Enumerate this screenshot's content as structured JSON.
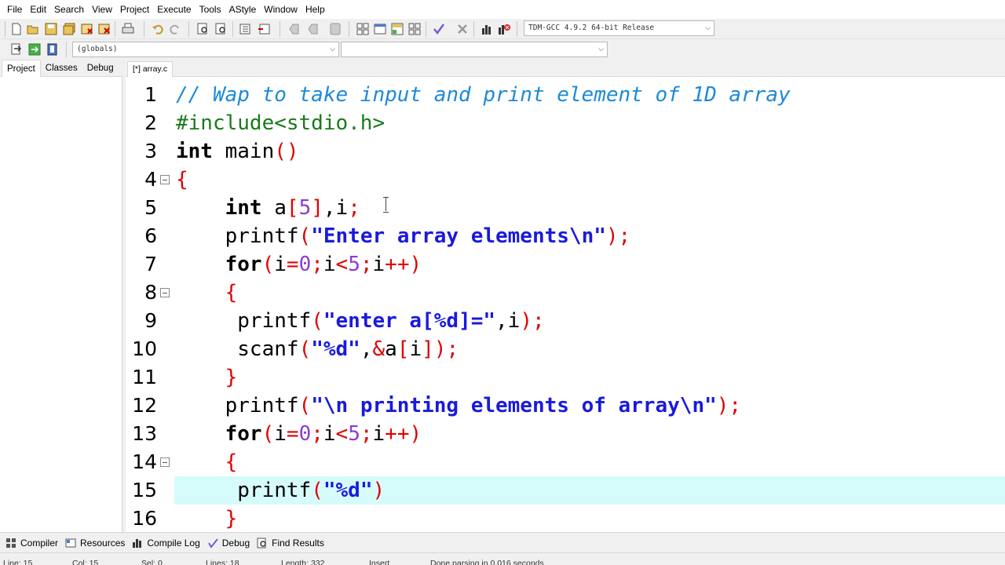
{
  "menu": [
    "File",
    "Edit",
    "Search",
    "View",
    "Project",
    "Execute",
    "Tools",
    "AStyle",
    "Window",
    "Help"
  ],
  "toolbar": {
    "compiler_select": "TDM-GCC 4.9.2 64-bit Release",
    "scope_select": "(globals)",
    "symbol_select": ""
  },
  "left_panel": {
    "tabs": [
      "Project",
      "Classes",
      "Debug"
    ],
    "active_tab": "Project"
  },
  "editor": {
    "tab_label": "[*] array.c",
    "current_line": 15,
    "lines": [
      {
        "n": "1",
        "fold": false
      },
      {
        "n": "2",
        "fold": false
      },
      {
        "n": "3",
        "fold": false
      },
      {
        "n": "4",
        "fold": true
      },
      {
        "n": "5",
        "fold": false
      },
      {
        "n": "6",
        "fold": false
      },
      {
        "n": "7",
        "fold": false
      },
      {
        "n": "8",
        "fold": true
      },
      {
        "n": "9",
        "fold": false
      },
      {
        "n": "10",
        "fold": false
      },
      {
        "n": "11",
        "fold": false
      },
      {
        "n": "12",
        "fold": false
      },
      {
        "n": "13",
        "fold": false
      },
      {
        "n": "14",
        "fold": true
      },
      {
        "n": "15",
        "fold": false
      },
      {
        "n": "16",
        "fold": false
      }
    ],
    "code": [
      "// Wap to take input and print element of 1D array",
      "#include<stdio.h>",
      "int main()",
      "{",
      "    int a[5],i;",
      "    printf(\"Enter array elements\\n\");",
      "    for(i=0;i<5;i++)",
      "    {",
      "     printf(\"enter a[%d]=\",i);",
      "     scanf(\"%d\",&a[i]);",
      "    }",
      "    printf(\"\\n printing elements of array\\n\");",
      "    for(i=0;i<5;i++)",
      "    {",
      "     printf(\"%d\")",
      "    }"
    ]
  },
  "bottom_tabs": [
    {
      "label": "Compiler",
      "icon": "compiler-icon"
    },
    {
      "label": "Resources",
      "icon": "resources-icon"
    },
    {
      "label": "Compile Log",
      "icon": "compile-log-icon"
    },
    {
      "label": "Debug",
      "icon": "debug-icon"
    },
    {
      "label": "Find Results",
      "icon": "find-results-icon"
    }
  ],
  "status": {
    "line": "Line:  15",
    "col": "Col:  15",
    "sel": "Sel:  0",
    "lines": "Lines:  18",
    "length": "Length:  332",
    "mode": "Insert",
    "message": "Done parsing in 0.016 seconds"
  },
  "colors": {
    "comment": "#1e8ad8",
    "preprocessor": "#1a7a1a",
    "string": "#1a1adc",
    "number": "#8a3bd6",
    "bracket": "#e00000",
    "current_line_bg": "#d6fbfb"
  }
}
